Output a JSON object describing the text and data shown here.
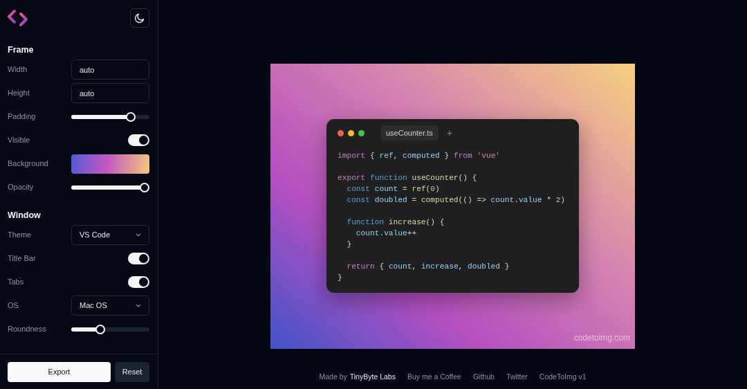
{
  "sidebar": {
    "sections": [
      {
        "title": "Frame",
        "rows": [
          {
            "label": "Width",
            "kind": "input",
            "value": "auto"
          },
          {
            "label": "Height",
            "kind": "input",
            "value": "auto"
          },
          {
            "label": "Padding",
            "kind": "slider",
            "level": 0.8
          },
          {
            "label": "Visible",
            "kind": "toggle",
            "on": true
          },
          {
            "label": "Background",
            "kind": "swatch"
          },
          {
            "label": "Opacity",
            "kind": "slider",
            "level": 1
          }
        ]
      },
      {
        "title": "Window",
        "rows": [
          {
            "label": "Theme",
            "kind": "select",
            "value": "VS Code"
          },
          {
            "label": "Title Bar",
            "kind": "toggle",
            "on": true
          },
          {
            "label": "Tabs",
            "kind": "toggle",
            "on": true
          },
          {
            "label": "OS",
            "kind": "select",
            "value": "Mac OS"
          },
          {
            "label": "Roundness",
            "kind": "slider",
            "level": 0.35
          }
        ]
      }
    ],
    "buttons": [
      {
        "label": "Export",
        "kind": "primary"
      },
      {
        "label": "Reset",
        "kind": "secondary"
      }
    ]
  },
  "editor": {
    "tab": "useCounter.ts",
    "add_tab": "+",
    "watermark": "codetoimg.com",
    "lines": [
      {
        "kind": "code",
        "tokens": [
          {
            "text": "import",
            "kind": "keyword"
          },
          {
            "text": " { ",
            "kind": "punct"
          },
          {
            "text": "ref",
            "kind": "variable"
          },
          {
            "text": ", ",
            "kind": "punct"
          },
          {
            "text": "computed",
            "kind": "variable"
          },
          {
            "text": " } ",
            "kind": "punct"
          },
          {
            "text": "from",
            "kind": "keyword"
          },
          {
            "text": " 'vue'",
            "kind": "string"
          }
        ]
      },
      {
        "kind": "blank"
      },
      {
        "kind": "code",
        "tokens": [
          {
            "text": "export",
            "kind": "keyword"
          },
          {
            "text": " function",
            "kind": "declaration"
          },
          {
            "text": " useCounter",
            "kind": "function"
          },
          {
            "text": "() {",
            "kind": "punct"
          }
        ]
      },
      {
        "kind": "code",
        "tokens": [
          {
            "text": "  const",
            "kind": "declaration"
          },
          {
            "text": " count",
            "kind": "variable"
          },
          {
            "text": " = ",
            "kind": "punct"
          },
          {
            "text": "ref",
            "kind": "function"
          },
          {
            "text": "(",
            "kind": "punct"
          },
          {
            "text": "0",
            "kind": "number"
          },
          {
            "text": ")",
            "kind": "punct"
          }
        ]
      },
      {
        "kind": "code",
        "tokens": [
          {
            "text": "  const",
            "kind": "declaration"
          },
          {
            "text": " doubled",
            "kind": "variable"
          },
          {
            "text": " = ",
            "kind": "punct"
          },
          {
            "text": "computed",
            "kind": "function"
          },
          {
            "text": "(() => ",
            "kind": "punct"
          },
          {
            "text": "count",
            "kind": "variable"
          },
          {
            "text": ".",
            "kind": "punct"
          },
          {
            "text": "value",
            "kind": "variable"
          },
          {
            "text": " * ",
            "kind": "punct"
          },
          {
            "text": "2",
            "kind": "number"
          },
          {
            "text": ")",
            "kind": "punct"
          }
        ]
      },
      {
        "kind": "blank"
      },
      {
        "kind": "code",
        "tokens": [
          {
            "text": "  function",
            "kind": "declaration"
          },
          {
            "text": " increase",
            "kind": "function"
          },
          {
            "text": "() {",
            "kind": "punct"
          }
        ]
      },
      {
        "kind": "code",
        "tokens": [
          {
            "text": "    count",
            "kind": "variable"
          },
          {
            "text": ".",
            "kind": "punct"
          },
          {
            "text": "value",
            "kind": "variable"
          },
          {
            "text": "++",
            "kind": "punct"
          }
        ]
      },
      {
        "kind": "code",
        "tokens": [
          {
            "text": "  }",
            "kind": "punct"
          }
        ]
      },
      {
        "kind": "blank"
      },
      {
        "kind": "code",
        "tokens": [
          {
            "text": "  return",
            "kind": "keyword"
          },
          {
            "text": " { ",
            "kind": "punct"
          },
          {
            "text": "count",
            "kind": "variable"
          },
          {
            "text": ", ",
            "kind": "punct"
          },
          {
            "text": "increase",
            "kind": "variable"
          },
          {
            "text": ", ",
            "kind": "punct"
          },
          {
            "text": "doubled",
            "kind": "variable"
          },
          {
            "text": " }",
            "kind": "punct"
          }
        ]
      },
      {
        "kind": "code",
        "tokens": [
          {
            "text": "}",
            "kind": "punct"
          }
        ]
      }
    ]
  },
  "footer": [
    {
      "text": "Made by",
      "kind": "text"
    },
    {
      "text": "TinyByte Labs",
      "kind": "strong-link"
    },
    {
      "text": "Buy me a Coffee",
      "kind": "link"
    },
    {
      "text": "Github",
      "kind": "link"
    },
    {
      "text": "Twitter",
      "kind": "link"
    },
    {
      "text": "CodeToImg v1",
      "kind": "link"
    }
  ]
}
